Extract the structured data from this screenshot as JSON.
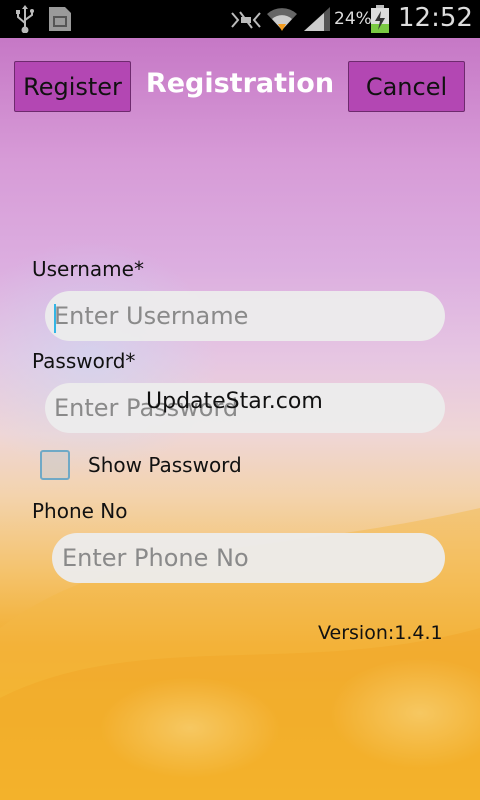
{
  "status_bar": {
    "battery_percent": "24%",
    "time": "12:52",
    "icons": [
      "usb-icon",
      "sim-card-icon",
      "mute-icon",
      "wifi-icon",
      "signal-icon",
      "battery-charging-icon"
    ]
  },
  "header": {
    "register_label": "Register",
    "title": "Registration",
    "cancel_label": "Cancel"
  },
  "form": {
    "username": {
      "label": "Username*",
      "placeholder": "Enter Username",
      "value": ""
    },
    "password": {
      "label": "Password*",
      "placeholder": "Enter Password",
      "value": ""
    },
    "show_password": {
      "label": "Show Password",
      "checked": false
    },
    "phone": {
      "label": "Phone No",
      "placeholder": "Enter Phone No",
      "value": ""
    }
  },
  "watermark": "UpdateStar.com",
  "version": "Version:1.4.1",
  "colors": {
    "button_bg": "#b347b3",
    "input_bg": "#ececec",
    "caret": "#33b5e5",
    "status_bar_bg": "#000000",
    "battery_charge": "#7ac943"
  }
}
